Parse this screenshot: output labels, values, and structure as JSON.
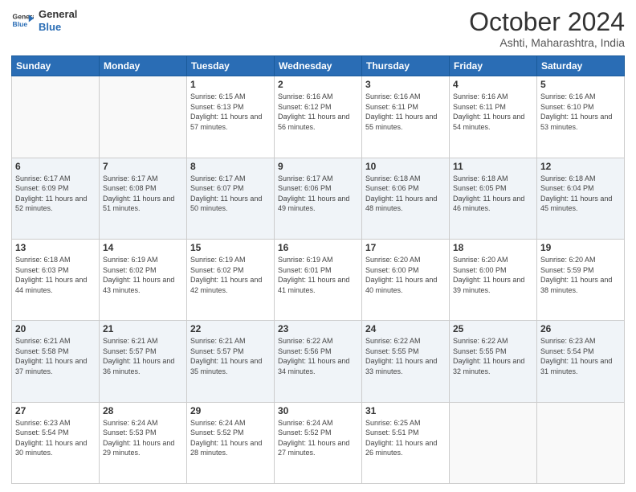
{
  "header": {
    "logo_line1": "General",
    "logo_line2": "Blue",
    "month": "October 2024",
    "location": "Ashti, Maharashtra, India"
  },
  "weekdays": [
    "Sunday",
    "Monday",
    "Tuesday",
    "Wednesday",
    "Thursday",
    "Friday",
    "Saturday"
  ],
  "weeks": [
    [
      {
        "day": "",
        "detail": ""
      },
      {
        "day": "",
        "detail": ""
      },
      {
        "day": "1",
        "detail": "Sunrise: 6:15 AM\nSunset: 6:13 PM\nDaylight: 11 hours and 57 minutes."
      },
      {
        "day": "2",
        "detail": "Sunrise: 6:16 AM\nSunset: 6:12 PM\nDaylight: 11 hours and 56 minutes."
      },
      {
        "day": "3",
        "detail": "Sunrise: 6:16 AM\nSunset: 6:11 PM\nDaylight: 11 hours and 55 minutes."
      },
      {
        "day": "4",
        "detail": "Sunrise: 6:16 AM\nSunset: 6:11 PM\nDaylight: 11 hours and 54 minutes."
      },
      {
        "day": "5",
        "detail": "Sunrise: 6:16 AM\nSunset: 6:10 PM\nDaylight: 11 hours and 53 minutes."
      }
    ],
    [
      {
        "day": "6",
        "detail": "Sunrise: 6:17 AM\nSunset: 6:09 PM\nDaylight: 11 hours and 52 minutes."
      },
      {
        "day": "7",
        "detail": "Sunrise: 6:17 AM\nSunset: 6:08 PM\nDaylight: 11 hours and 51 minutes."
      },
      {
        "day": "8",
        "detail": "Sunrise: 6:17 AM\nSunset: 6:07 PM\nDaylight: 11 hours and 50 minutes."
      },
      {
        "day": "9",
        "detail": "Sunrise: 6:17 AM\nSunset: 6:06 PM\nDaylight: 11 hours and 49 minutes."
      },
      {
        "day": "10",
        "detail": "Sunrise: 6:18 AM\nSunset: 6:06 PM\nDaylight: 11 hours and 48 minutes."
      },
      {
        "day": "11",
        "detail": "Sunrise: 6:18 AM\nSunset: 6:05 PM\nDaylight: 11 hours and 46 minutes."
      },
      {
        "day": "12",
        "detail": "Sunrise: 6:18 AM\nSunset: 6:04 PM\nDaylight: 11 hours and 45 minutes."
      }
    ],
    [
      {
        "day": "13",
        "detail": "Sunrise: 6:18 AM\nSunset: 6:03 PM\nDaylight: 11 hours and 44 minutes."
      },
      {
        "day": "14",
        "detail": "Sunrise: 6:19 AM\nSunset: 6:02 PM\nDaylight: 11 hours and 43 minutes."
      },
      {
        "day": "15",
        "detail": "Sunrise: 6:19 AM\nSunset: 6:02 PM\nDaylight: 11 hours and 42 minutes."
      },
      {
        "day": "16",
        "detail": "Sunrise: 6:19 AM\nSunset: 6:01 PM\nDaylight: 11 hours and 41 minutes."
      },
      {
        "day": "17",
        "detail": "Sunrise: 6:20 AM\nSunset: 6:00 PM\nDaylight: 11 hours and 40 minutes."
      },
      {
        "day": "18",
        "detail": "Sunrise: 6:20 AM\nSunset: 6:00 PM\nDaylight: 11 hours and 39 minutes."
      },
      {
        "day": "19",
        "detail": "Sunrise: 6:20 AM\nSunset: 5:59 PM\nDaylight: 11 hours and 38 minutes."
      }
    ],
    [
      {
        "day": "20",
        "detail": "Sunrise: 6:21 AM\nSunset: 5:58 PM\nDaylight: 11 hours and 37 minutes."
      },
      {
        "day": "21",
        "detail": "Sunrise: 6:21 AM\nSunset: 5:57 PM\nDaylight: 11 hours and 36 minutes."
      },
      {
        "day": "22",
        "detail": "Sunrise: 6:21 AM\nSunset: 5:57 PM\nDaylight: 11 hours and 35 minutes."
      },
      {
        "day": "23",
        "detail": "Sunrise: 6:22 AM\nSunset: 5:56 PM\nDaylight: 11 hours and 34 minutes."
      },
      {
        "day": "24",
        "detail": "Sunrise: 6:22 AM\nSunset: 5:55 PM\nDaylight: 11 hours and 33 minutes."
      },
      {
        "day": "25",
        "detail": "Sunrise: 6:22 AM\nSunset: 5:55 PM\nDaylight: 11 hours and 32 minutes."
      },
      {
        "day": "26",
        "detail": "Sunrise: 6:23 AM\nSunset: 5:54 PM\nDaylight: 11 hours and 31 minutes."
      }
    ],
    [
      {
        "day": "27",
        "detail": "Sunrise: 6:23 AM\nSunset: 5:54 PM\nDaylight: 11 hours and 30 minutes."
      },
      {
        "day": "28",
        "detail": "Sunrise: 6:24 AM\nSunset: 5:53 PM\nDaylight: 11 hours and 29 minutes."
      },
      {
        "day": "29",
        "detail": "Sunrise: 6:24 AM\nSunset: 5:52 PM\nDaylight: 11 hours and 28 minutes."
      },
      {
        "day": "30",
        "detail": "Sunrise: 6:24 AM\nSunset: 5:52 PM\nDaylight: 11 hours and 27 minutes."
      },
      {
        "day": "31",
        "detail": "Sunrise: 6:25 AM\nSunset: 5:51 PM\nDaylight: 11 hours and 26 minutes."
      },
      {
        "day": "",
        "detail": ""
      },
      {
        "day": "",
        "detail": ""
      }
    ]
  ]
}
